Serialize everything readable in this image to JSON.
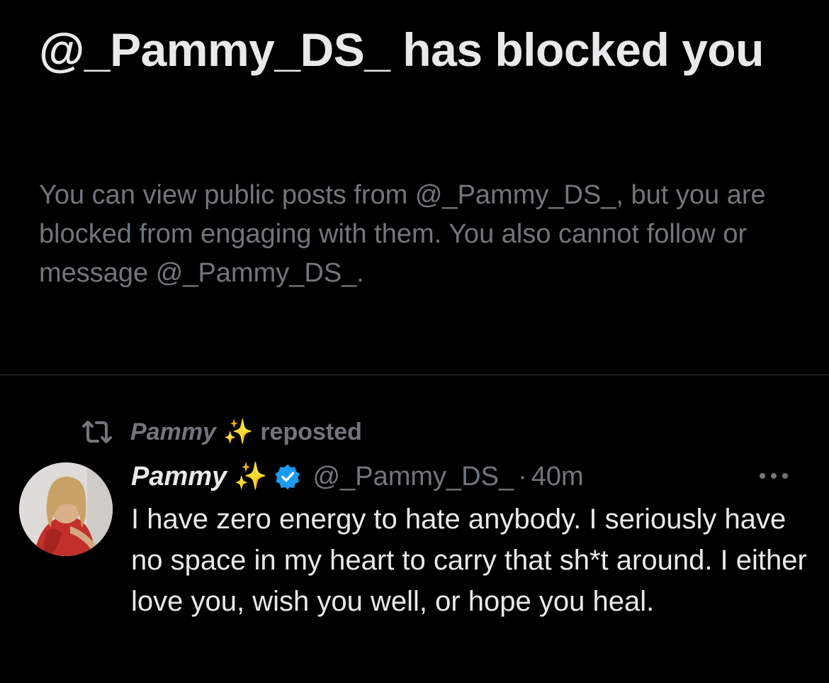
{
  "blocked_notice": {
    "title": "@_Pammy_DS_ has blocked you",
    "description": "You can view public posts from @_Pammy_DS_, but you are blocked from engaging with them. You also cannot follow or message @_Pammy_DS_."
  },
  "repost": {
    "name": "Pammy",
    "sparkle": "✨",
    "label": "reposted"
  },
  "tweet": {
    "display_name": "Pammy",
    "sparkle": "✨",
    "handle": "@_Pammy_DS_",
    "separator": "·",
    "time": "40m",
    "text": "I have zero energy to hate anybody. I seriously have no space in my heart to carry that sh*t around. I either love you, wish you well, or hope you heal."
  },
  "colors": {
    "background": "#000000",
    "primary_text": "#e7e9ea",
    "secondary_text": "#71767b",
    "divider": "#2f3336",
    "verified_blue": "#1d9bf0"
  },
  "icons": {
    "repost": "repost-icon",
    "verified": "verified-badge-icon",
    "more": "more-horizontal-icon",
    "avatar": "profile-photo"
  }
}
